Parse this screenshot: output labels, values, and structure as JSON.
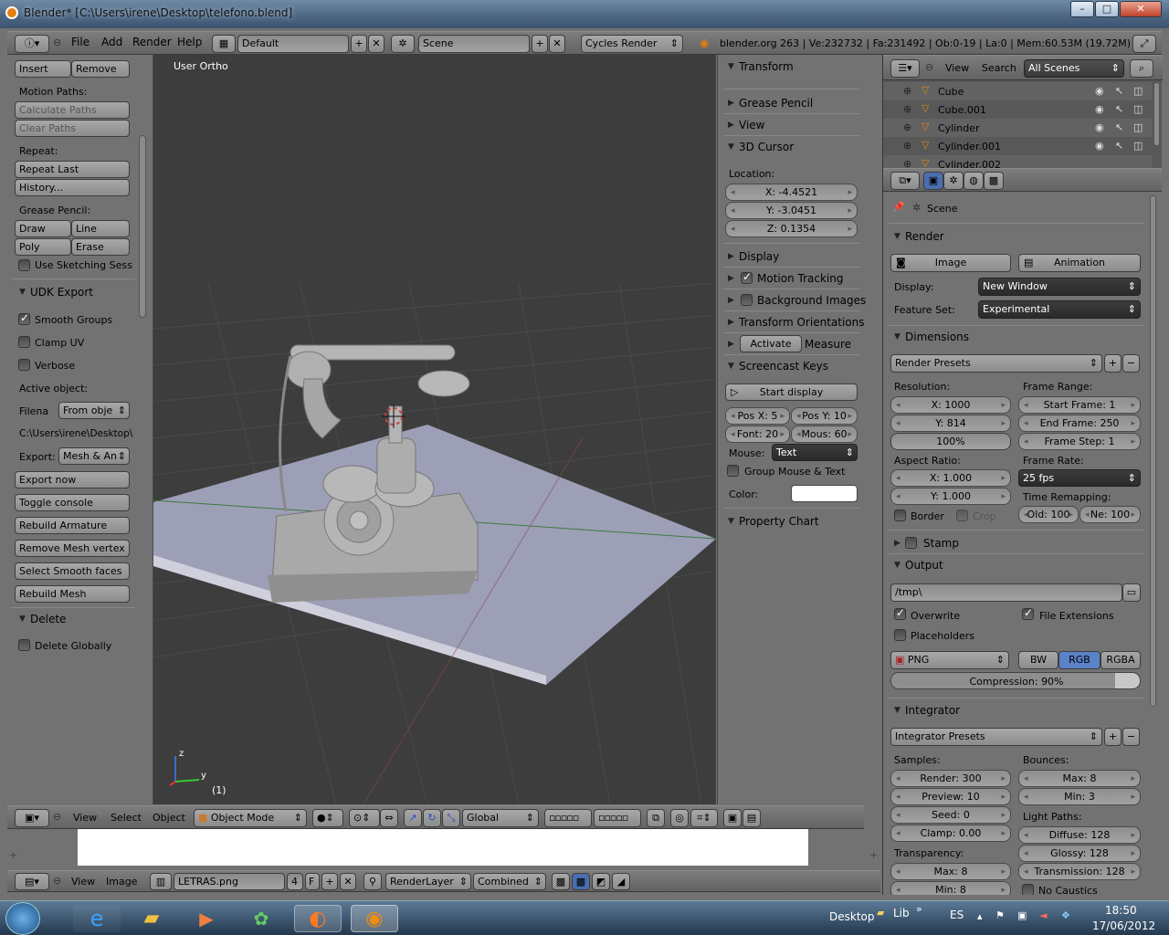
{
  "window": {
    "title": "Blender* [C:\\Users\\irene\\Desktop\\telefono.blend]",
    "btn_min": "–",
    "btn_max": "□",
    "btn_close": "✕"
  },
  "info_header": {
    "menus": [
      "File",
      "Add",
      "Render",
      "Help"
    ],
    "screen_layout": "Default",
    "scene": "Scene",
    "render_engine": "Cycles Render",
    "stats": "blender.org 263 | Ve:232732 | Fa:231492 | Ob:0-19 | La:0 | Mem:60.53M (19.72M)"
  },
  "toolshelf": {
    "insert": "Insert",
    "remove": "Remove",
    "motion_paths_label": "Motion Paths:",
    "calculate_paths": "Calculate Paths",
    "clear_paths": "Clear Paths",
    "repeat_label": "Repeat:",
    "repeat_last": "Repeat Last",
    "history": "History...",
    "grease_pencil_label": "Grease Pencil:",
    "draw": "Draw",
    "line": "Line",
    "poly": "Poly",
    "erase": "Erase",
    "use_sketching": "Use Sketching Sessio",
    "udk_export_title": "UDK Export",
    "smooth_groups": "Smooth Groups",
    "clamp_uv": "Clamp UV",
    "verbose": "Verbose",
    "active_object_label": "Active object:",
    "filena_label": "Filena",
    "filena_value": "From obje",
    "path": "C:\\Users\\irene\\Desktop\\",
    "export_label": "Export:",
    "export_value": "Mesh & An",
    "export_now": "Export now",
    "toggle_console": "Toggle console",
    "rebuild_armature": "Rebuild Armature",
    "remove_mesh_vertex": "Remove Mesh vertex w",
    "select_smooth_faces": "Select Smooth faces",
    "rebuild_mesh": "Rebuild Mesh",
    "delete_title": "Delete",
    "delete_globally": "Delete Globally"
  },
  "viewport": {
    "label": "User Ortho",
    "frame": "(1)",
    "axis_z": "z",
    "axis_y": "y"
  },
  "view3d_header": {
    "menus": [
      "View",
      "Select",
      "Object"
    ],
    "mode": "Object Mode",
    "orientation": "Global"
  },
  "properties_n": {
    "transform": "Transform",
    "grease_pencil": "Grease Pencil",
    "view": "View",
    "cursor": "3D Cursor",
    "location_label": "Location:",
    "x": "X: -4.4521",
    "y": "Y: -3.0451",
    "z": "Z: 0.1354",
    "display": "Display",
    "motion_tracking": "Motion Tracking",
    "background_images": "Background Images",
    "transform_orientations": "Transform Orientations",
    "activate": "Activate",
    "measure": "Measure",
    "screencast_keys": "Screencast Keys",
    "start_display": "Start display",
    "pos_x": "Pos X: 5",
    "pos_y": "Pos Y: 10",
    "font": "Font: 20",
    "mous": "Mous: 60",
    "mouse_label": "Mouse:",
    "mouse_value": "Text",
    "group_mouse_text": "Group Mouse & Text",
    "color_label": "Color:",
    "property_chart": "Property Chart"
  },
  "outliner": {
    "menus": [
      "View",
      "Search"
    ],
    "filter": "All Scenes",
    "items": [
      "Cube",
      "Cube.001",
      "Cylinder",
      "Cylinder.001",
      "Cylinder.002"
    ]
  },
  "props": {
    "scene": "Scene",
    "render_title": "Render",
    "image": "Image",
    "animation": "Animation",
    "display_label": "Display:",
    "display_value": "New Window",
    "feature_label": "Feature Set:",
    "feature_value": "Experimental",
    "dimensions_title": "Dimensions",
    "render_presets": "Render Presets",
    "resolution_label": "Resolution:",
    "res_x": "X: 1000",
    "res_y": "Y: 814",
    "res_pct": "100%",
    "frame_range_label": "Frame Range:",
    "start_frame": "Start Frame: 1",
    "end_frame": "End Frame: 250",
    "frame_step": "Frame Step: 1",
    "aspect_label": "Aspect Ratio:",
    "asp_x": "X: 1.000",
    "asp_y": "Y: 1.000",
    "frame_rate_label": "Frame Rate:",
    "fps": "25 fps",
    "time_remap_label": "Time Remapping:",
    "old": "Old: 100",
    "new": "Ne: 100",
    "border": "Border",
    "crop": "Crop",
    "stamp_title": "Stamp",
    "output_title": "Output",
    "output_path": "/tmp\\",
    "overwrite": "Overwrite",
    "file_extensions": "File Extensions",
    "placeholders": "Placeholders",
    "format": "PNG",
    "bw": "BW",
    "rgb": "RGB",
    "rgba": "RGBA",
    "compression": "Compression: 90%",
    "compression_value": 0.9,
    "integrator_title": "Integrator",
    "integrator_presets": "Integrator Presets",
    "samples_label": "Samples:",
    "render_samples": "Render: 300",
    "preview_samples": "Preview: 10",
    "seed": "Seed: 0",
    "clamp": "Clamp: 0.00",
    "bounces_label": "Bounces:",
    "b_max": "Max: 8",
    "b_min": "Min: 3",
    "light_paths_label": "Light Paths:",
    "diffuse": "Diffuse: 128",
    "glossy": "Glossy: 128",
    "transmission": "Transmission: 128",
    "transparency_label": "Transparency:",
    "t_max": "Max: 8",
    "t_min": "Min: 8",
    "no_caustics": "No Caustics"
  },
  "image_header": {
    "menus": [
      "View",
      "Image"
    ],
    "image_name": "LETRAS.png",
    "users": "4",
    "fake": "F",
    "layer": "RenderLayer",
    "pass": "Combined"
  },
  "taskbar": {
    "desktop": "Desktop",
    "lib": "Lib",
    "lang": "ES",
    "time": "18:50",
    "date": "17/06/2012"
  }
}
